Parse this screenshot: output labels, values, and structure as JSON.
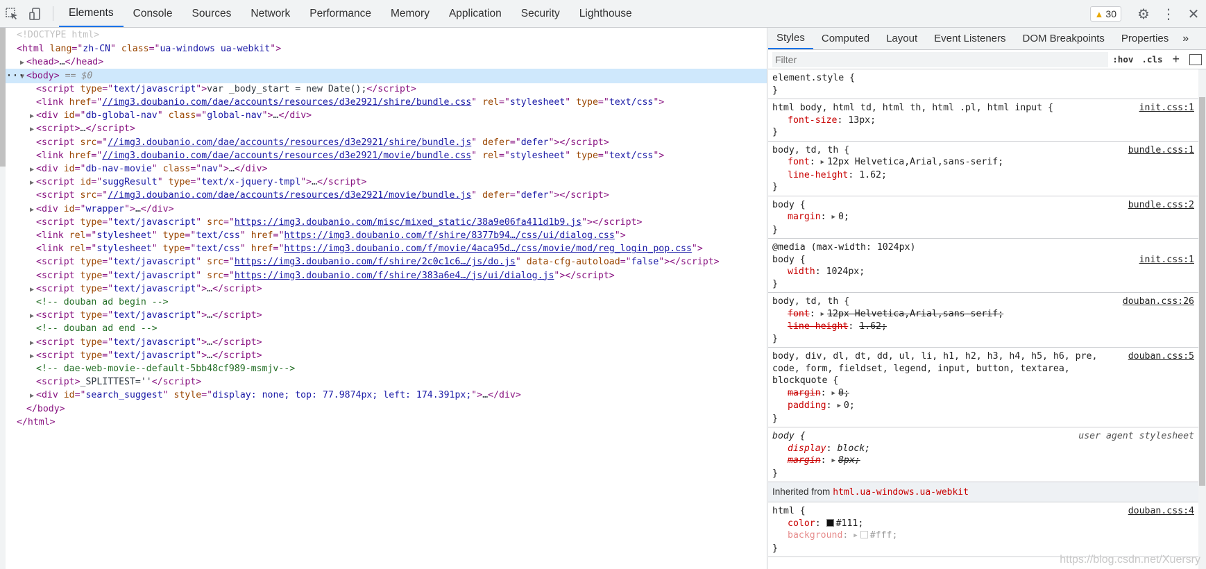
{
  "toolbar": {
    "tabs": [
      {
        "label": "Elements",
        "active": true
      },
      {
        "label": "Console"
      },
      {
        "label": "Sources"
      },
      {
        "label": "Network"
      },
      {
        "label": "Performance"
      },
      {
        "label": "Memory"
      },
      {
        "label": "Application"
      },
      {
        "label": "Security"
      },
      {
        "label": "Lighthouse"
      }
    ],
    "warning_count": "30"
  },
  "dom": {
    "doctype": "<!DOCTYPE html>",
    "lines": [
      {
        "indent": 0,
        "arrow": "",
        "html": "<span class='t-tag'>&lt;html </span><span class='t-attr'>lang</span><span class='t-tag'>=\"</span><span class='t-val'>zh-CN</span><span class='t-tag'>\" </span><span class='t-attr'>class</span><span class='t-tag'>=\"</span><span class='t-val'>ua-windows ua-webkit</span><span class='t-tag'>\"&gt;</span>"
      },
      {
        "indent": 1,
        "arrow": "▶",
        "html": "<span class='t-tag'>&lt;head&gt;</span><span class='t-text'>…</span><span class='t-tag'>&lt;/head&gt;</span>"
      },
      {
        "indent": 1,
        "arrow": "▼",
        "selected": true,
        "html": "<span class='t-tag'>&lt;body&gt;</span> <span class='t-eq'>== $0</span>"
      },
      {
        "indent": 2,
        "arrow": "",
        "html": "<span class='t-tag'>&lt;script </span><span class='t-attr'>type</span><span class='t-tag'>=\"</span><span class='t-val'>text/javascript</span><span class='t-tag'>\"&gt;</span><span class='t-text'>var _body_start = new Date();</span><span class='t-tag'>&lt;/script&gt;</span>"
      },
      {
        "indent": 2,
        "arrow": "",
        "html": "<span class='t-tag'>&lt;link </span><span class='t-attr'>href</span><span class='t-tag'>=\"</span><span class='t-link'>//img3.doubanio.com/dae/accounts/resources/d3e2921/shire/bundle.css</span><span class='t-tag'>\" </span><span class='t-attr'>rel</span><span class='t-tag'>=\"</span><span class='t-val'>stylesheet</span><span class='t-tag'>\" </span><span class='t-attr'>type</span><span class='t-tag'>=\"</span><span class='t-val'>text/css</span><span class='t-tag'>\"&gt;</span>"
      },
      {
        "indent": 2,
        "arrow": "▶",
        "html": "<span class='t-tag'>&lt;div </span><span class='t-attr'>id</span><span class='t-tag'>=\"</span><span class='t-val'>db-global-nav</span><span class='t-tag'>\" </span><span class='t-attr'>class</span><span class='t-tag'>=\"</span><span class='t-val'>global-nav</span><span class='t-tag'>\"&gt;</span><span class='t-text'>…</span><span class='t-tag'>&lt;/div&gt;</span>"
      },
      {
        "indent": 2,
        "arrow": "▶",
        "html": "<span class='t-tag'>&lt;script&gt;</span><span class='t-text'>…</span><span class='t-tag'>&lt;/script&gt;</span>"
      },
      {
        "indent": 2,
        "arrow": "",
        "html": "<span class='t-tag'>&lt;script </span><span class='t-attr'>src</span><span class='t-tag'>=\"</span><span class='t-link'>//img3.doubanio.com/dae/accounts/resources/d3e2921/shire/bundle.js</span><span class='t-tag'>\" </span><span class='t-attr'>defer</span><span class='t-tag'>=\"</span><span class='t-val'>defer</span><span class='t-tag'>\"&gt;&lt;/script&gt;</span>"
      },
      {
        "indent": 2,
        "arrow": "",
        "html": "<span class='t-tag'>&lt;link </span><span class='t-attr'>href</span><span class='t-tag'>=\"</span><span class='t-link'>//img3.doubanio.com/dae/accounts/resources/d3e2921/movie/bundle.css</span><span class='t-tag'>\" </span><span class='t-attr'>rel</span><span class='t-tag'>=\"</span><span class='t-val'>stylesheet</span><span class='t-tag'>\" </span><span class='t-attr'>type</span><span class='t-tag'>=\"</span><span class='t-val'>text/css</span><span class='t-tag'>\"&gt;</span>"
      },
      {
        "indent": 2,
        "arrow": "▶",
        "html": "<span class='t-tag'>&lt;div </span><span class='t-attr'>id</span><span class='t-tag'>=\"</span><span class='t-val'>db-nav-movie</span><span class='t-tag'>\" </span><span class='t-attr'>class</span><span class='t-tag'>=\"</span><span class='t-val'>nav</span><span class='t-tag'>\"&gt;</span><span class='t-text'>…</span><span class='t-tag'>&lt;/div&gt;</span>"
      },
      {
        "indent": 2,
        "arrow": "▶",
        "html": "<span class='t-tag'>&lt;script </span><span class='t-attr'>id</span><span class='t-tag'>=\"</span><span class='t-val'>suggResult</span><span class='t-tag'>\" </span><span class='t-attr'>type</span><span class='t-tag'>=\"</span><span class='t-val'>text/x-jquery-tmpl</span><span class='t-tag'>\"&gt;</span><span class='t-text'>…</span><span class='t-tag'>&lt;/script&gt;</span>"
      },
      {
        "indent": 2,
        "arrow": "",
        "html": "<span class='t-tag'>&lt;script </span><span class='t-attr'>src</span><span class='t-tag'>=\"</span><span class='t-link'>//img3.doubanio.com/dae/accounts/resources/d3e2921/movie/bundle.js</span><span class='t-tag'>\" </span><span class='t-attr'>defer</span><span class='t-tag'>=\"</span><span class='t-val'>defer</span><span class='t-tag'>\"&gt;&lt;/script&gt;</span>"
      },
      {
        "indent": 2,
        "arrow": "▶",
        "html": "<span class='t-tag'>&lt;div </span><span class='t-attr'>id</span><span class='t-tag'>=\"</span><span class='t-val'>wrapper</span><span class='t-tag'>\"&gt;</span><span class='t-text'>…</span><span class='t-tag'>&lt;/div&gt;</span>"
      },
      {
        "indent": 2,
        "arrow": "",
        "html": "<span class='t-tag'>&lt;script </span><span class='t-attr'>type</span><span class='t-tag'>=\"</span><span class='t-val'>text/javascript</span><span class='t-tag'>\" </span><span class='t-attr'>src</span><span class='t-tag'>=\"</span><span class='t-link'>https://img3.doubanio.com/misc/mixed_static/38a9e06fa411d1b9.js</span><span class='t-tag'>\"&gt;&lt;/script&gt;</span>"
      },
      {
        "indent": 2,
        "arrow": "",
        "html": "<span class='t-tag'>&lt;link </span><span class='t-attr'>rel</span><span class='t-tag'>=\"</span><span class='t-val'>stylesheet</span><span class='t-tag'>\" </span><span class='t-attr'>type</span><span class='t-tag'>=\"</span><span class='t-val'>text/css</span><span class='t-tag'>\" </span><span class='t-attr'>href</span><span class='t-tag'>=\"</span><span class='t-link'>https://img3.doubanio.com/f/shire/8377b94…/css/ui/dialog.css</span><span class='t-tag'>\"&gt;</span>"
      },
      {
        "indent": 2,
        "arrow": "",
        "html": "<span class='t-tag'>&lt;link </span><span class='t-attr'>rel</span><span class='t-tag'>=\"</span><span class='t-val'>stylesheet</span><span class='t-tag'>\" </span><span class='t-attr'>type</span><span class='t-tag'>=\"</span><span class='t-val'>text/css</span><span class='t-tag'>\" </span><span class='t-attr'>href</span><span class='t-tag'>=\"</span><span class='t-link'>https://img3.doubanio.com/f/movie/4aca95d…/css/movie/mod/reg_login_pop.css</span><span class='t-tag'>\"&gt;</span>"
      },
      {
        "indent": 2,
        "arrow": "",
        "html": "<span class='t-tag'>&lt;script </span><span class='t-attr'>type</span><span class='t-tag'>=\"</span><span class='t-val'>text/javascript</span><span class='t-tag'>\" </span><span class='t-attr'>src</span><span class='t-tag'>=\"</span><span class='t-link'>https://img3.doubanio.com/f/shire/2c0c1c6…/js/do.js</span><span class='t-tag'>\" </span><span class='t-attr'>data-cfg-autoload</span><span class='t-tag'>=\"</span><span class='t-val'>false</span><span class='t-tag'>\"&gt;&lt;/script&gt;</span>"
      },
      {
        "indent": 2,
        "arrow": "",
        "html": "<span class='t-tag'>&lt;script </span><span class='t-attr'>type</span><span class='t-tag'>=\"</span><span class='t-val'>text/javascript</span><span class='t-tag'>\" </span><span class='t-attr'>src</span><span class='t-tag'>=\"</span><span class='t-link'>https://img3.doubanio.com/f/shire/383a6e4…/js/ui/dialog.js</span><span class='t-tag'>\"&gt;&lt;/script&gt;</span>"
      },
      {
        "indent": 2,
        "arrow": "▶",
        "html": "<span class='t-tag'>&lt;script </span><span class='t-attr'>type</span><span class='t-tag'>=\"</span><span class='t-val'>text/javascript</span><span class='t-tag'>\"&gt;</span><span class='t-text'>…</span><span class='t-tag'>&lt;/script&gt;</span>"
      },
      {
        "indent": 2,
        "arrow": "",
        "html": "<span class='t-comment'>&lt;!-- douban ad begin --&gt;</span>"
      },
      {
        "indent": 2,
        "arrow": "▶",
        "html": "<span class='t-tag'>&lt;script </span><span class='t-attr'>type</span><span class='t-tag'>=\"</span><span class='t-val'>text/javascript</span><span class='t-tag'>\"&gt;</span><span class='t-text'>…</span><span class='t-tag'>&lt;/script&gt;</span>"
      },
      {
        "indent": 2,
        "arrow": "",
        "html": "<span class='t-comment'>&lt;!-- douban ad end --&gt;</span>"
      },
      {
        "indent": 2,
        "arrow": "▶",
        "html": "<span class='t-tag'>&lt;script </span><span class='t-attr'>type</span><span class='t-tag'>=\"</span><span class='t-val'>text/javascript</span><span class='t-tag'>\"&gt;</span><span class='t-text'>…</span><span class='t-tag'>&lt;/script&gt;</span>"
      },
      {
        "indent": 2,
        "arrow": "▶",
        "html": "<span class='t-tag'>&lt;script </span><span class='t-attr'>type</span><span class='t-tag'>=\"</span><span class='t-val'>text/javascript</span><span class='t-tag'>\"&gt;</span><span class='t-text'>…</span><span class='t-tag'>&lt;/script&gt;</span>"
      },
      {
        "indent": 2,
        "arrow": "",
        "html": "<span class='t-comment'>&lt;!-- dae-web-movie--default-5bb48cf989-msmjv--&gt;</span>"
      },
      {
        "indent": 2,
        "arrow": "",
        "html": "<span class='t-tag'>&lt;script&gt;</span><span class='t-text'>_SPLITTEST=''</span><span class='t-tag'>&lt;/script&gt;</span>"
      },
      {
        "indent": 2,
        "arrow": "▶",
        "html": "<span class='t-tag'>&lt;div </span><span class='t-attr'>id</span><span class='t-tag'>=\"</span><span class='t-val'>search_suggest</span><span class='t-tag'>\" </span><span class='t-attr'>style</span><span class='t-tag'>=\"</span><span class='t-val'>display: none; top: 77.9874px; left: 174.391px;</span><span class='t-tag'>\"&gt;</span><span class='t-text'>…</span><span class='t-tag'>&lt;/div&gt;</span>"
      },
      {
        "indent": 1,
        "arrow": "",
        "html": "<span class='t-tag'>&lt;/body&gt;</span>"
      },
      {
        "indent": 0,
        "arrow": "",
        "html": "<span class='t-tag'>&lt;/html&gt;</span>"
      }
    ]
  },
  "styles": {
    "subtabs": [
      {
        "label": "Styles",
        "active": true
      },
      {
        "label": "Computed"
      },
      {
        "label": "Layout"
      },
      {
        "label": "Event Listeners"
      },
      {
        "label": "DOM Breakpoints"
      },
      {
        "label": "Properties"
      }
    ],
    "more_label": "»",
    "filter_placeholder": "Filter",
    "hov_label": ":hov",
    "cls_label": ".cls",
    "add_label": "+",
    "rules": [
      {
        "selector": "element.style {",
        "source": "",
        "decls": []
      },
      {
        "selector": "html body, html td, html th, html .pl, html input {",
        "source": "init.css:1",
        "decls": [
          {
            "name": "font-size",
            "value": "13px;"
          }
        ]
      },
      {
        "selector": "body, td, th {",
        "source": "bundle.css:1",
        "decls": [
          {
            "name": "font",
            "value": "12px Helvetica,Arial,sans-serif;",
            "tri": true
          },
          {
            "name": "line-height",
            "value": "1.62;"
          }
        ]
      },
      {
        "selector": "body {",
        "source": "bundle.css:2",
        "decls": [
          {
            "name": "margin",
            "value": "0;",
            "tri": true
          }
        ]
      },
      {
        "media": "@media (max-width: 1024px)",
        "selector": "body {",
        "source": "init.css:1",
        "decls": [
          {
            "name": "width",
            "value": "1024px;"
          }
        ]
      },
      {
        "selector": "body, td, th {",
        "source": "douban.css:26",
        "decls": [
          {
            "name": "font",
            "value": "12px Helvetica,Arial,sans-serif;",
            "tri": true,
            "struck": true
          },
          {
            "name": "line-height",
            "value": "1.62;",
            "struck": true
          }
        ]
      },
      {
        "selector": "body, div, dl, dt, dd, ul, li, h1, h2, h3, h4, h5, h6, pre,\ncode, form, fieldset, legend, input, button, textarea, blockquote {",
        "source": "douban.css:5",
        "decls": [
          {
            "name": "margin",
            "value": "0;",
            "tri": true,
            "struck": true
          },
          {
            "name": "padding",
            "value": "0;",
            "tri": true
          }
        ]
      },
      {
        "selector": "body {",
        "source": "user agent stylesheet",
        "ua": true,
        "decls": [
          {
            "name": "display",
            "value": "block;",
            "ua": true
          },
          {
            "name": "margin",
            "value": "8px;",
            "tri": true,
            "struck": true,
            "ua": true
          }
        ]
      }
    ],
    "inherited_label": "Inherited from",
    "inherited_selector": "html.ua-windows.ua-webkit",
    "inherited_rule": {
      "selector": "html {",
      "source": "douban.css:4",
      "decls": [
        {
          "name": "color",
          "value": "#111;",
          "swatch": "#111111"
        },
        {
          "name": "background",
          "value": "#fff;",
          "tri": true,
          "swatch": "#ffffff",
          "faded": true
        }
      ]
    }
  },
  "watermark": "https://blog.csdn.net/Xuersry"
}
